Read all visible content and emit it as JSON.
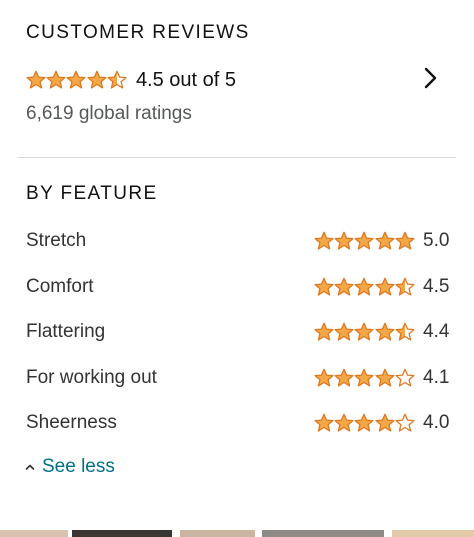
{
  "reviews": {
    "title": "CUSTOMER REVIEWS",
    "rating": 4.5,
    "out_of_text": "4.5 out of 5",
    "global_ratings": "6,619 global ratings"
  },
  "by_feature": {
    "title": "BY FEATURE",
    "items": [
      {
        "name": "Stretch",
        "rating": 5.0,
        "value": "5.0"
      },
      {
        "name": "Comfort",
        "rating": 4.5,
        "value": "4.5"
      },
      {
        "name": "Flattering",
        "rating": 4.4,
        "value": "4.4"
      },
      {
        "name": "For working out",
        "rating": 4.1,
        "value": "4.1"
      },
      {
        "name": "Sheerness",
        "rating": 4.0,
        "value": "4.0"
      }
    ]
  },
  "see_less": {
    "label": "See less",
    "icon": "caret-up-icon"
  },
  "icons": {
    "star": "star-icon",
    "chevron": "chevron-right-icon"
  },
  "colors": {
    "star_fill": "#f3a847",
    "star_stroke": "#de7921",
    "link": "#007185",
    "divider": "#d5d9d9"
  }
}
